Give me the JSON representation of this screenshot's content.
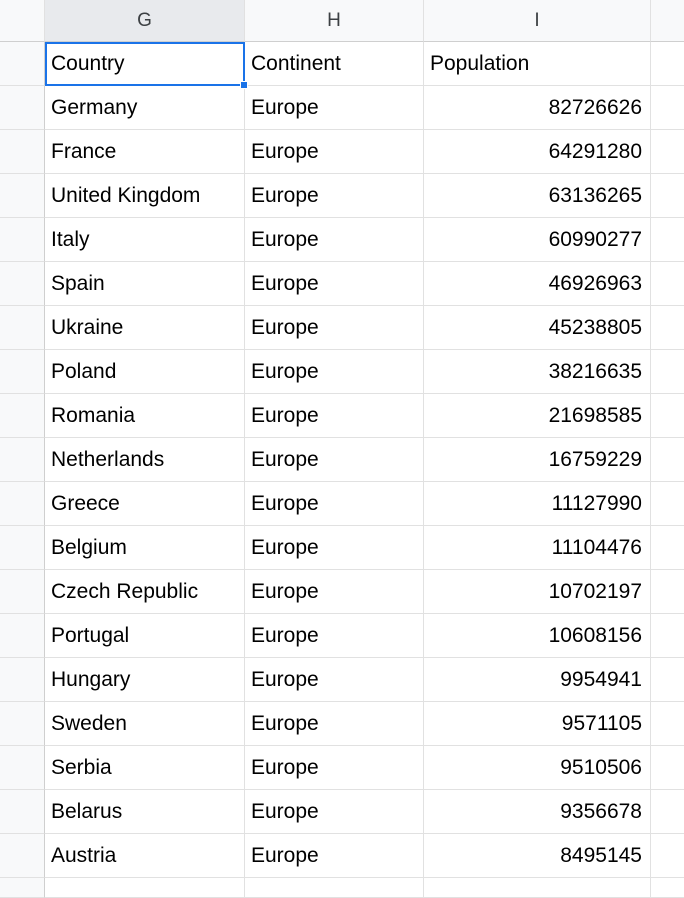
{
  "columns": [
    {
      "id": "G",
      "width": "col-g",
      "selected": true
    },
    {
      "id": "H",
      "width": "col-h",
      "selected": false
    },
    {
      "id": "I",
      "width": "col-i",
      "selected": false
    },
    {
      "id": "J",
      "width": "col-j",
      "selected": false
    }
  ],
  "headerRow": {
    "country": "Country",
    "continent": "Continent",
    "population": "Population"
  },
  "rows": [
    {
      "country": "Germany",
      "continent": "Europe",
      "population": "82726626"
    },
    {
      "country": "France",
      "continent": "Europe",
      "population": "64291280"
    },
    {
      "country": "United Kingdom",
      "continent": "Europe",
      "population": "63136265"
    },
    {
      "country": "Italy",
      "continent": "Europe",
      "population": "60990277"
    },
    {
      "country": "Spain",
      "continent": "Europe",
      "population": "46926963"
    },
    {
      "country": "Ukraine",
      "continent": "Europe",
      "population": "45238805"
    },
    {
      "country": "Poland",
      "continent": "Europe",
      "population": "38216635"
    },
    {
      "country": "Romania",
      "continent": "Europe",
      "population": "21698585"
    },
    {
      "country": "Netherlands",
      "continent": "Europe",
      "population": "16759229"
    },
    {
      "country": "Greece",
      "continent": "Europe",
      "population": "11127990"
    },
    {
      "country": "Belgium",
      "continent": "Europe",
      "population": "11104476"
    },
    {
      "country": "Czech Republic",
      "continent": "Europe",
      "population": "10702197"
    },
    {
      "country": "Portugal",
      "continent": "Europe",
      "population": "10608156"
    },
    {
      "country": "Hungary",
      "continent": "Europe",
      "population": "9954941"
    },
    {
      "country": "Sweden",
      "continent": "Europe",
      "population": "9571105"
    },
    {
      "country": "Serbia",
      "continent": "Europe",
      "population": "9510506"
    },
    {
      "country": "Belarus",
      "continent": "Europe",
      "population": "9356678"
    },
    {
      "country": "Austria",
      "continent": "Europe",
      "population": "8495145"
    }
  ],
  "selectedCell": "G1"
}
